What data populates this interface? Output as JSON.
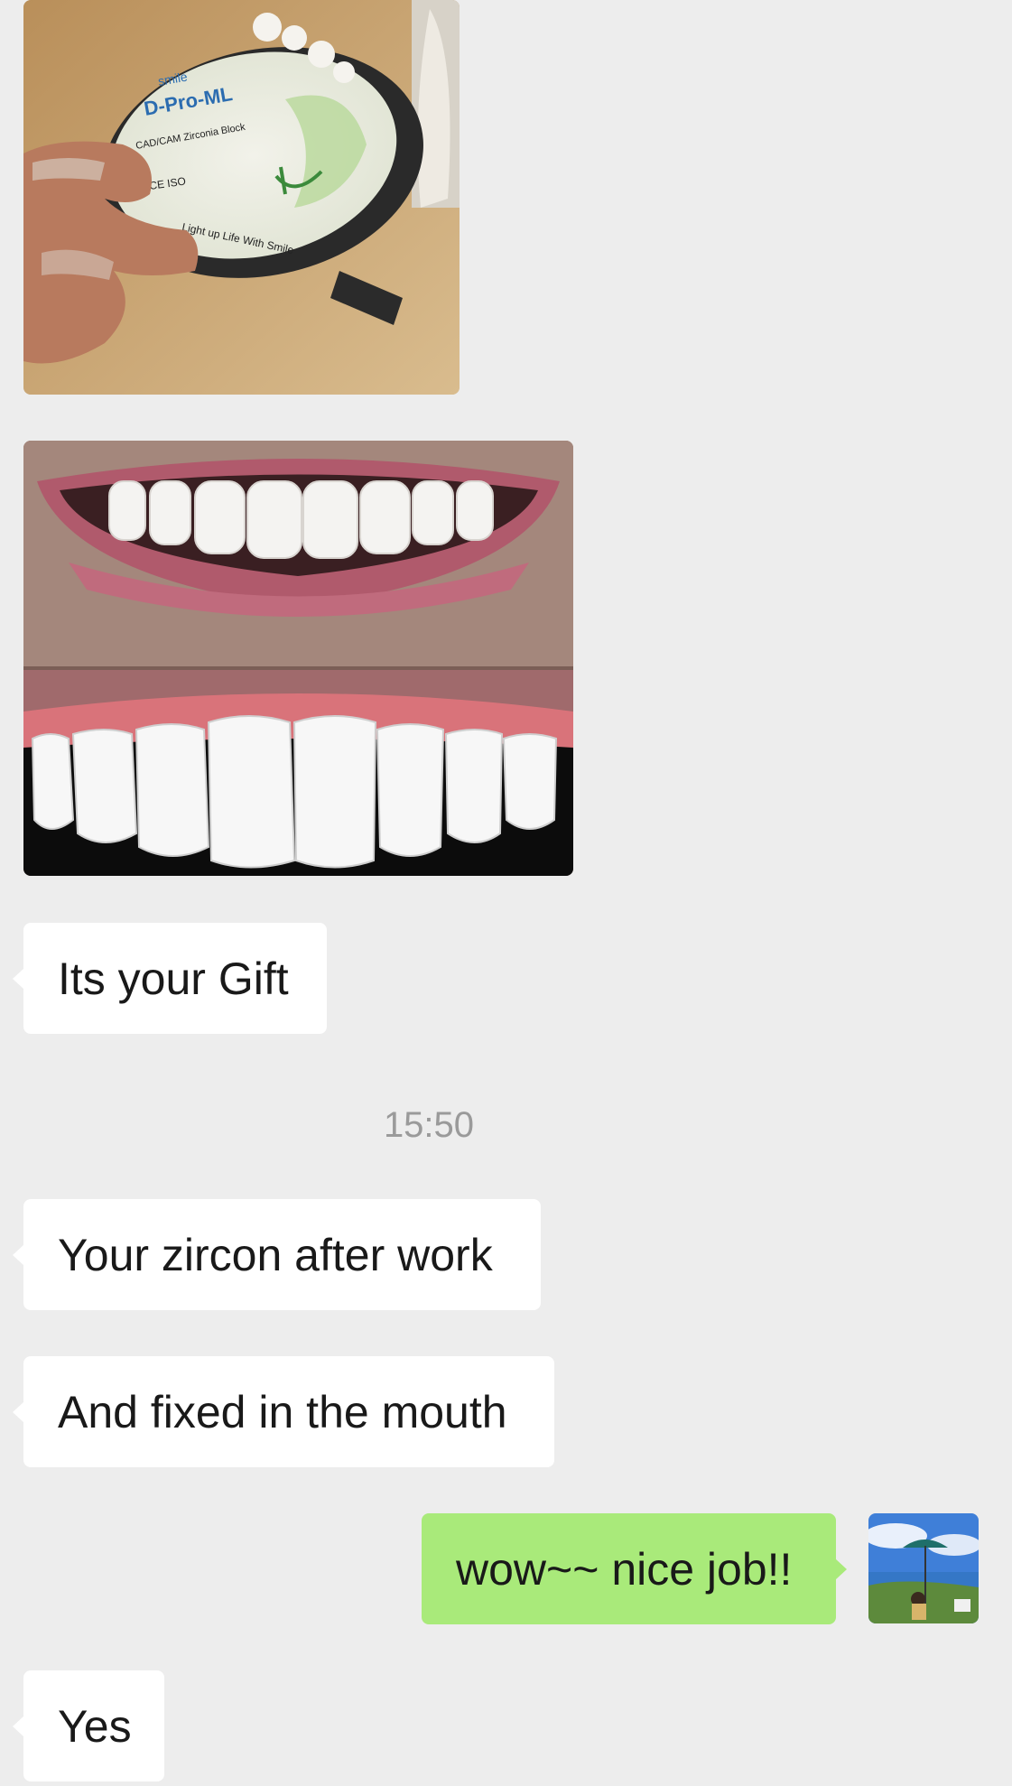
{
  "chat": {
    "images": [
      {
        "label": "zirconia-block-photo",
        "brand_text": "smile",
        "product_text": "D-Pro-ML",
        "subtitle_text": "CAD/CAM Zirconia Block",
        "cert_text": "CE ISO",
        "slogan_text": "Light up Life With Smile"
      },
      {
        "label": "teeth-before-after-photo"
      }
    ],
    "messages": [
      {
        "side": "left",
        "text": "Its your Gift"
      },
      {
        "side": "left",
        "text": "Your zircon after work"
      },
      {
        "side": "left",
        "text": "And fixed in the mouth"
      },
      {
        "side": "right",
        "text": "wow~~ nice job!!"
      },
      {
        "side": "left",
        "text": "Yes"
      }
    ],
    "timestamp": "15:50"
  },
  "colors": {
    "background": "#ededed",
    "incoming_bubble": "#ffffff",
    "outgoing_bubble": "#a9ea7a",
    "timestamp": "#9a9a9a"
  }
}
